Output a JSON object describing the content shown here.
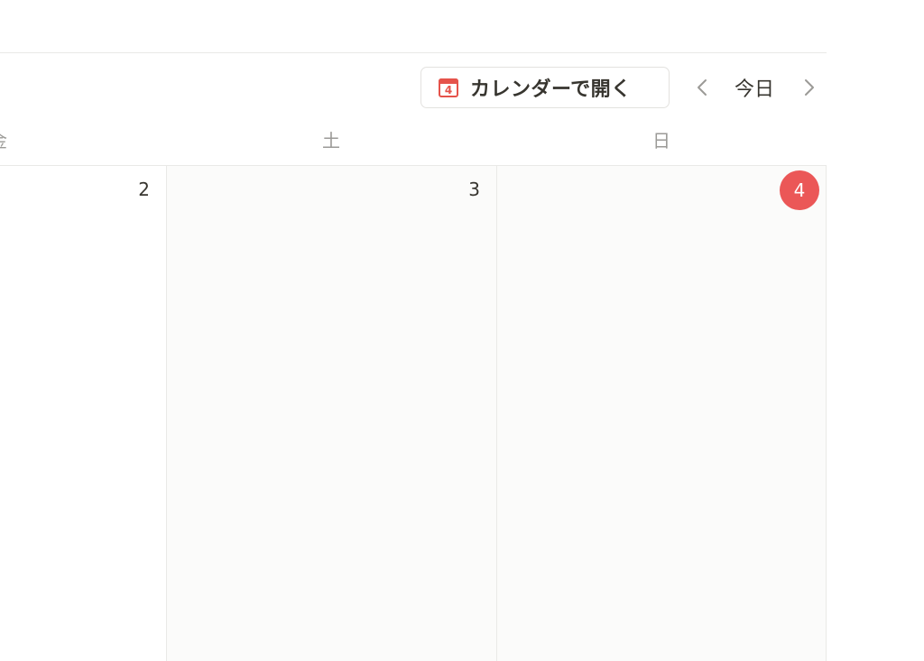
{
  "toolbar": {
    "open_calendar_label": "カレンダーで開く",
    "calendar_icon_number": "4",
    "today_label": "今日",
    "prev_icon": "chevron-left-icon",
    "next_icon": "chevron-right-icon"
  },
  "weekdays": [
    "金",
    "土",
    "日"
  ],
  "days": [
    {
      "number": "2",
      "weekend": false
    },
    {
      "number": "3",
      "weekend": true
    },
    {
      "number": "4",
      "weekend": true,
      "today": true
    }
  ],
  "colors": {
    "accent_red": "#eb5757",
    "weekend_bg": "#fbfbfa",
    "border": "#e9e9e7",
    "muted_text": "#9b9a97"
  }
}
